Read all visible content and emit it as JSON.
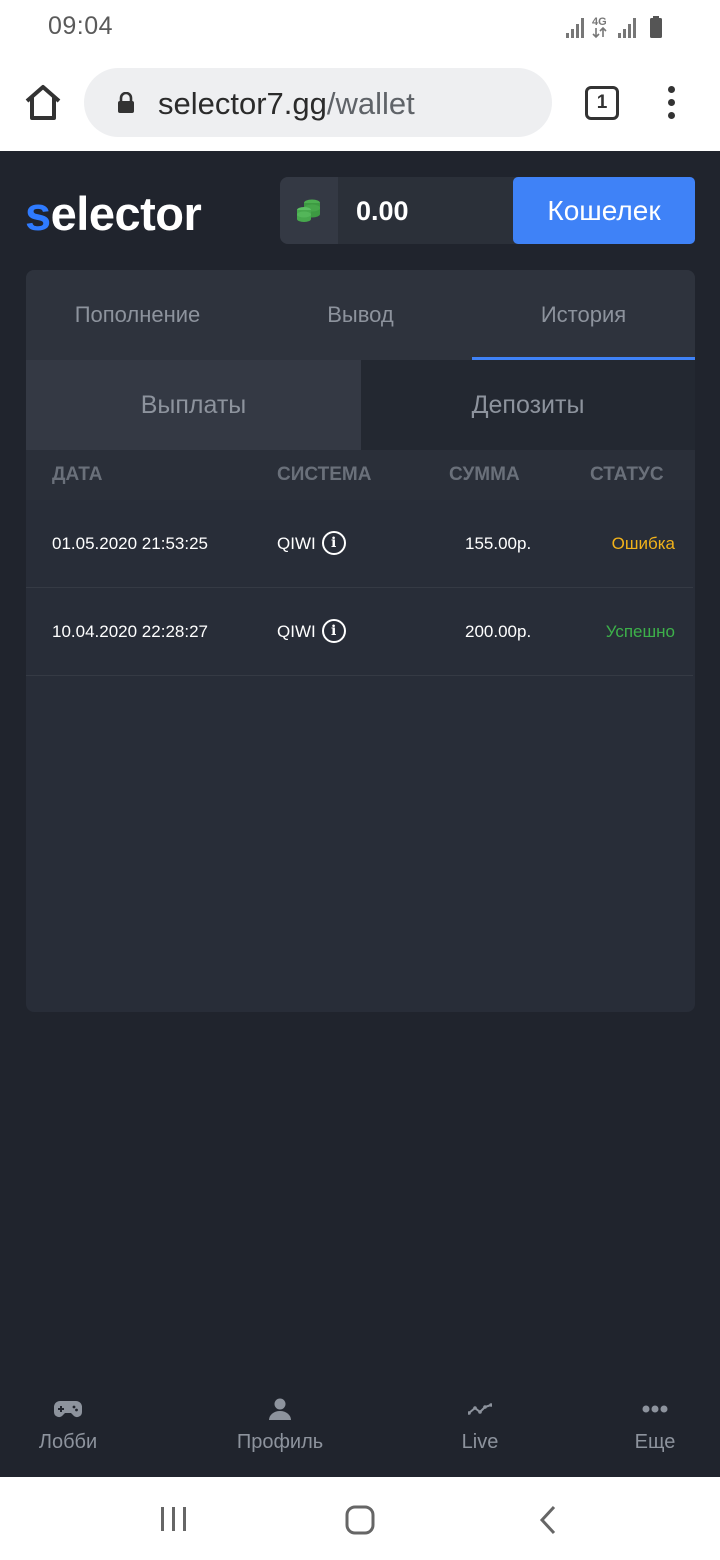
{
  "status_bar": {
    "time": "09:04",
    "network": "4G"
  },
  "browser": {
    "url_host": "selector7.gg",
    "url_path": "/wallet",
    "tab_count": "1"
  },
  "header": {
    "logo_first": "s",
    "logo_rest": "elector",
    "balance": "0.00",
    "wallet_button": "Кошелек"
  },
  "tabs": [
    "Пополнение",
    "Вывод",
    "История"
  ],
  "active_tab": "История",
  "sub_tabs": [
    "Выплаты",
    "Депозиты"
  ],
  "table": {
    "headers": [
      "ДАТА",
      "СИСТЕМА",
      "СУММА",
      "СТАТУС"
    ],
    "rows": [
      {
        "date": "01.05.2020 21:53:25",
        "system": "QIWI",
        "amount": "155.00р.",
        "status": "Ошибка",
        "status_color": "#f2b21a"
      },
      {
        "date": "10.04.2020 22:28:27",
        "system": "QIWI",
        "amount": "200.00р.",
        "status": "Успешно",
        "status_color": "#3db04a"
      }
    ]
  },
  "bottom_nav": [
    {
      "label": "Лобби",
      "icon": "gamepad-icon"
    },
    {
      "label": "Профиль",
      "icon": "user-icon"
    },
    {
      "label": "Live",
      "icon": "live-chart-icon"
    },
    {
      "label": "Еще",
      "icon": "more-dots-icon"
    }
  ],
  "colors": {
    "accent": "#3f82f7",
    "background": "#20242d",
    "card": "#282d38",
    "error": "#f2b21a",
    "success": "#3db04a"
  }
}
